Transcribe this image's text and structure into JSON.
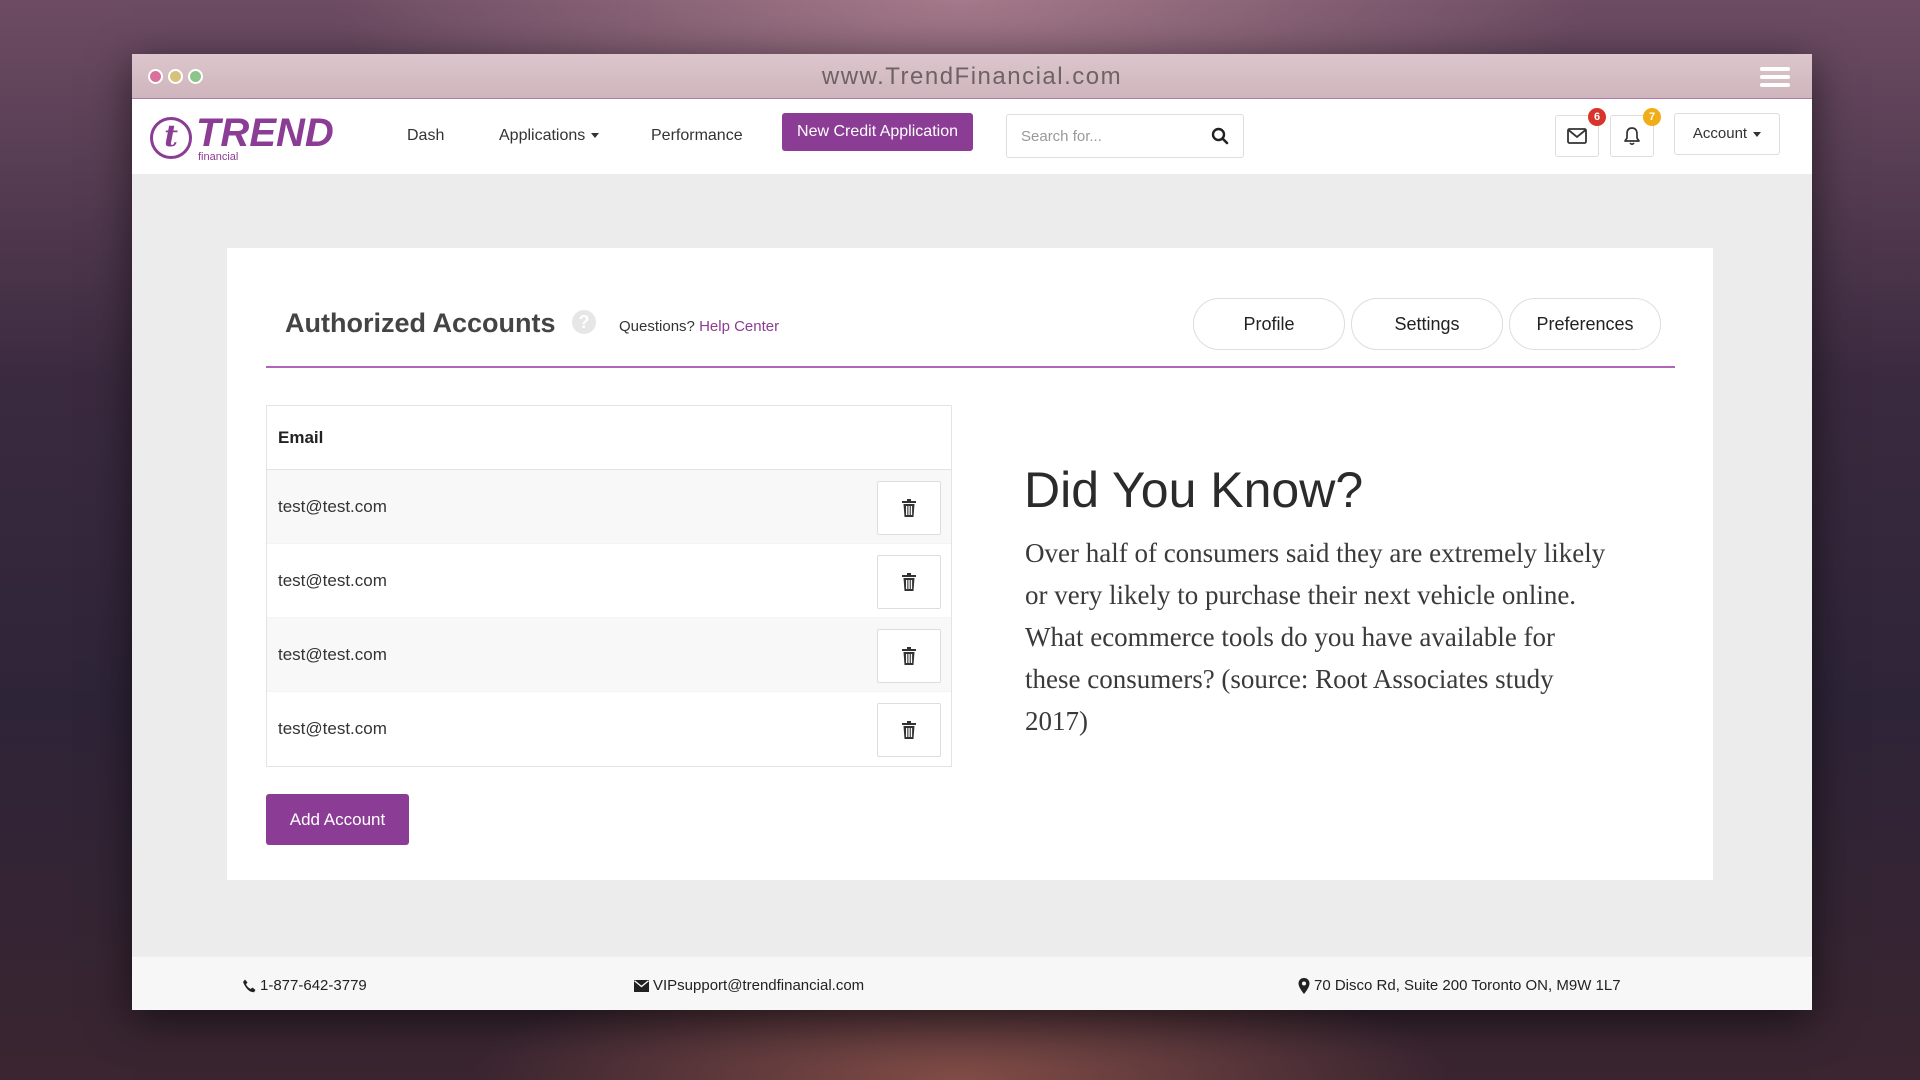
{
  "window": {
    "url": "www.TrendFinancial.com"
  },
  "brand": {
    "logo_letter": "t",
    "logo_word": "TREND",
    "logo_sub": "financial",
    "accent_color": "#8b3c94"
  },
  "nav": {
    "dash": "Dash",
    "applications": "Applications",
    "performance": "Performance",
    "new_credit_button": "New Credit Application",
    "search_placeholder": "Search for...",
    "mail_count": "6",
    "notifications_count": "7",
    "account": "Account"
  },
  "header": {
    "title": "Authorized Accounts",
    "help_icon_text": "?",
    "questions_text": "Questions?",
    "help_center_link": "Help Center",
    "tabs": [
      "Profile",
      "Settings",
      "Preferences"
    ]
  },
  "table": {
    "column": "Email",
    "rows": [
      "test@test.com",
      "test@test.com",
      "test@test.com",
      "test@test.com"
    ]
  },
  "add_button": "Add Account",
  "did_you_know": {
    "title": "Did You Know?",
    "body": "Over half of consumers said they are extremely likely or very likely to purchase their next vehicle online. What ecommerce tools do you have available for these consumers? (source: Root Associates study 2017)"
  },
  "footer": {
    "phone": "1-877-642-3779",
    "email": "VIPsupport@trendfinancial.com",
    "address": "70 Disco Rd, Suite 200 Toronto ON, M9W 1L7"
  }
}
